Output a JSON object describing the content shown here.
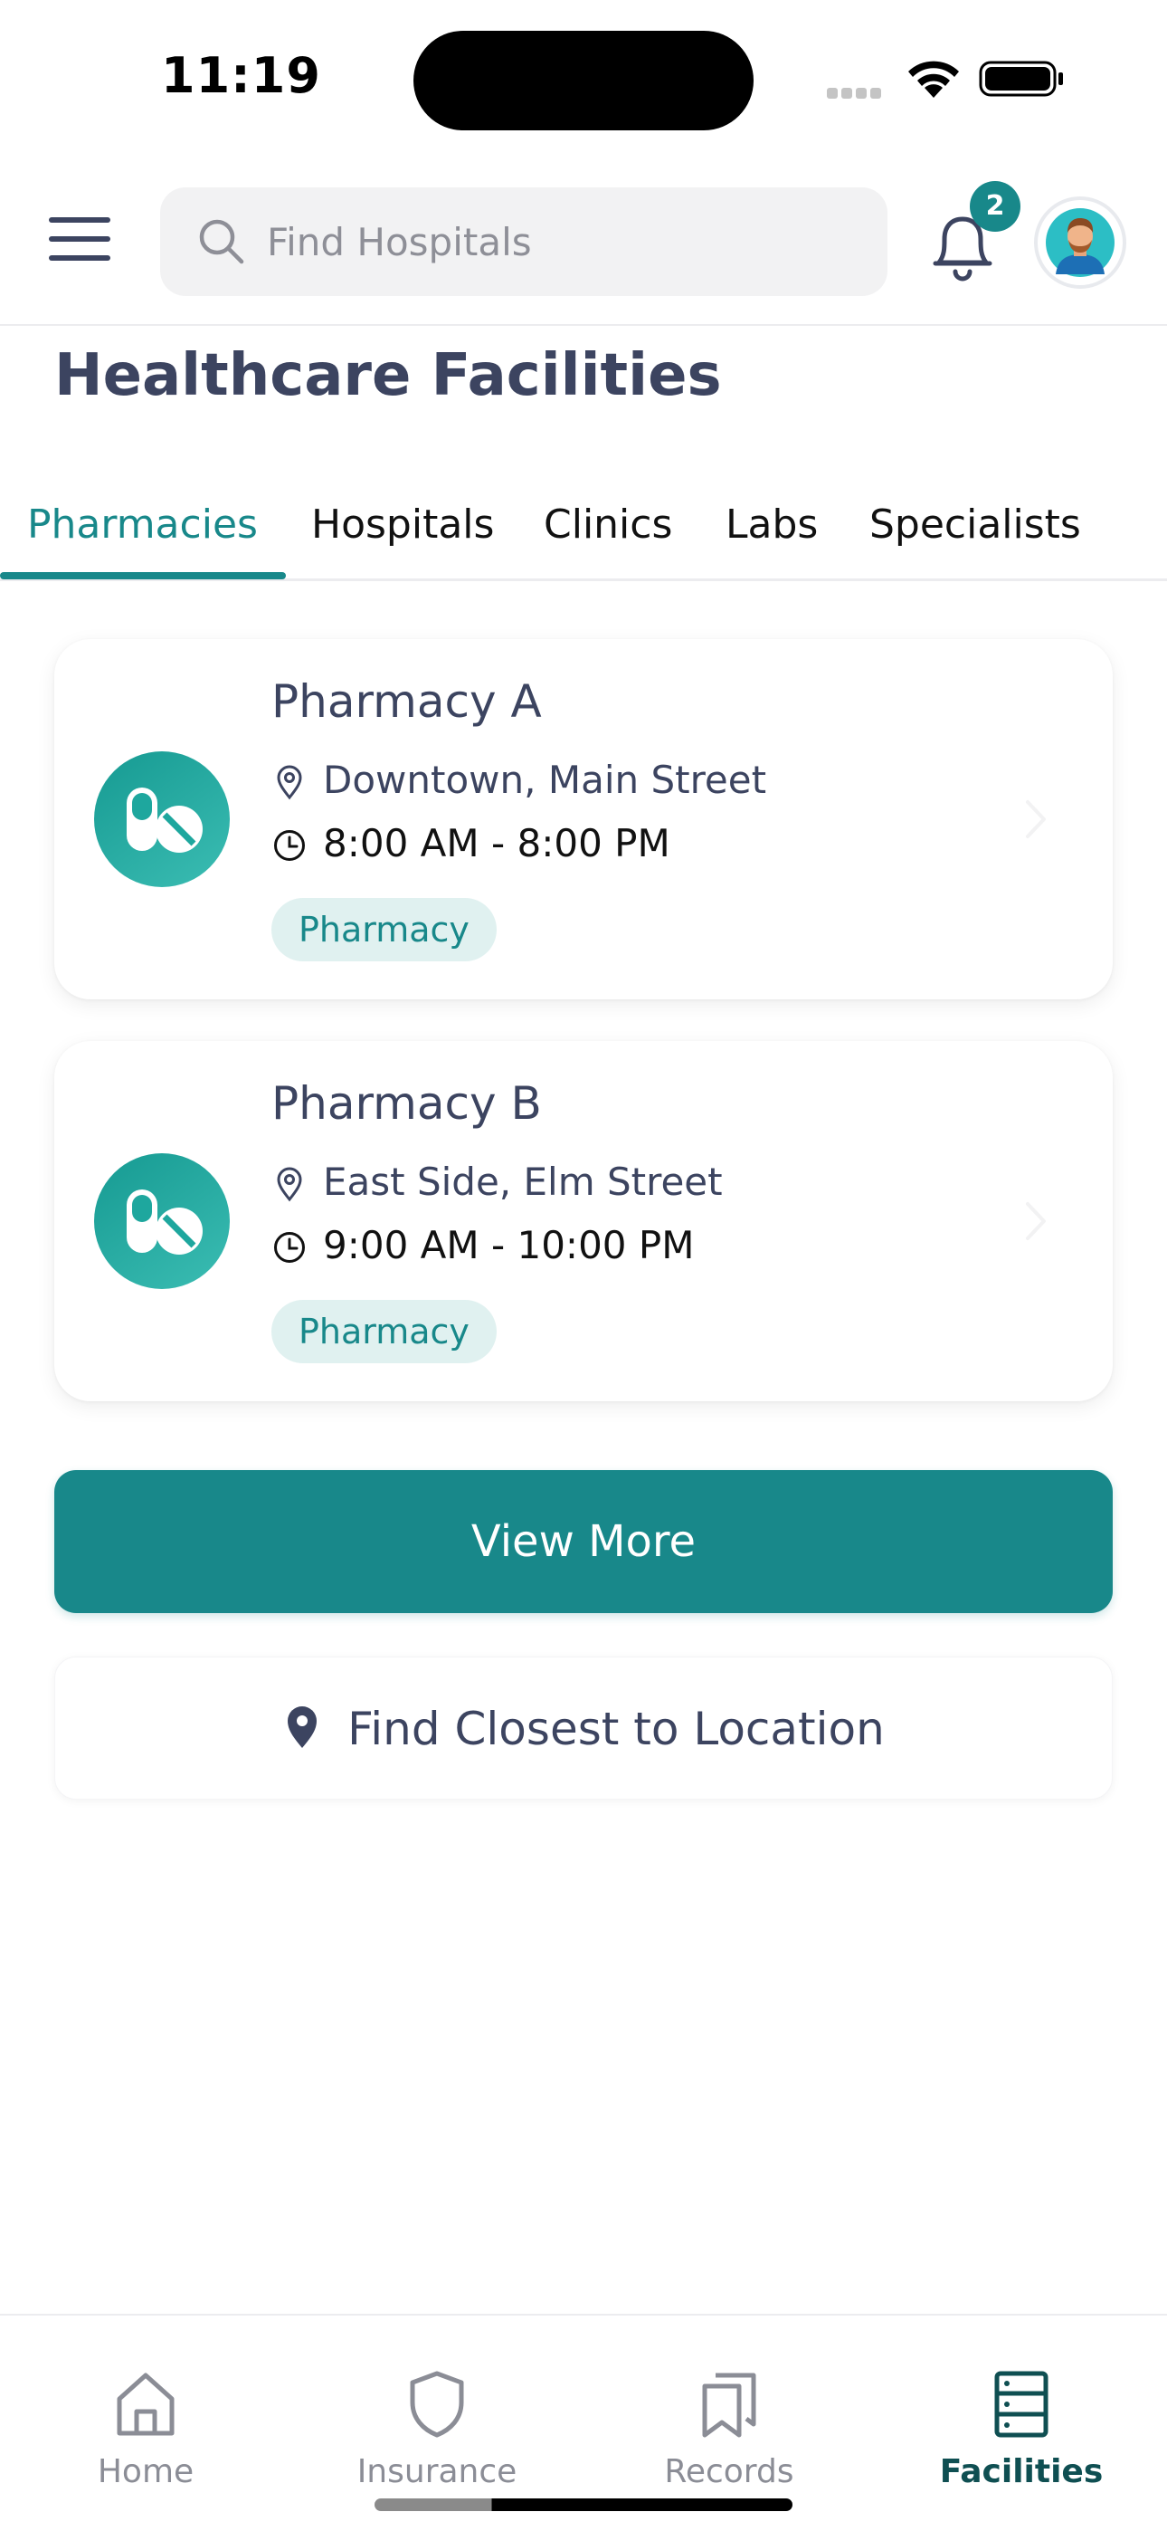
{
  "status_bar": {
    "time": "11:19"
  },
  "header": {
    "search": {
      "placeholder": "Find Hospitals"
    },
    "notification_count": "2"
  },
  "page": {
    "title": "Healthcare Facilities"
  },
  "tabs": [
    {
      "label": "Pharmacies",
      "active": true
    },
    {
      "label": "Hospitals",
      "active": false
    },
    {
      "label": "Clinics",
      "active": false
    },
    {
      "label": "Labs",
      "active": false
    },
    {
      "label": "Specialists",
      "active": false
    }
  ],
  "facilities": [
    {
      "name": "Pharmacy A",
      "location": "Downtown, Main Street",
      "hours": "8:00 AM - 8:00 PM",
      "type": "Pharmacy",
      "icon": "pills-icon"
    },
    {
      "name": "Pharmacy B",
      "location": "East Side, Elm Street",
      "hours": "9:00 AM - 10:00 PM",
      "type": "Pharmacy",
      "icon": "pills-icon"
    }
  ],
  "actions": {
    "view_more": "View More",
    "find_closest": "Find Closest to Location"
  },
  "bottom_nav": [
    {
      "label": "Home",
      "icon": "home-icon",
      "active": false
    },
    {
      "label": "Insurance",
      "icon": "shield-icon",
      "active": false
    },
    {
      "label": "Records",
      "icon": "bookmarks-icon",
      "active": false
    },
    {
      "label": "Facilities",
      "icon": "server-rack-icon",
      "active": true
    }
  ],
  "colors": {
    "accent": "#18888a",
    "text": "#3c4460",
    "tag_bg": "#e0f1f0",
    "nav_active": "#0f4f52"
  }
}
